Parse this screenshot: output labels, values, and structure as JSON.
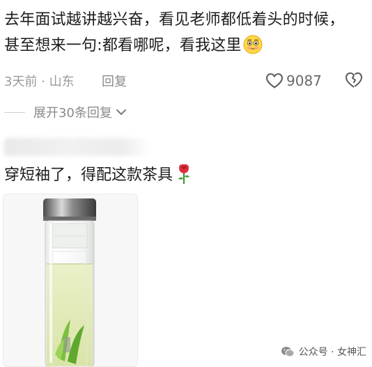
{
  "comment1": {
    "line1": "去年面试越讲越兴奋，看见老师都低着头的时候，",
    "line2": "甚至想来一句:都看哪呢，看我这里",
    "emoji_icon": "flushed-face-icon"
  },
  "meta": {
    "time_location": "3天前 · 山东",
    "reply_label": "回复",
    "like_count": "9087",
    "like_icon": "heart-outline-icon",
    "dislike_icon": "broken-heart-icon"
  },
  "expand": {
    "label": "展开30条回复",
    "icon": "chevron-down-icon"
  },
  "comment2": {
    "text": "穿短袖了，得配这款茶具",
    "emoji_icon": "rose-icon"
  },
  "watermark": {
    "text": "公众号 · 女神汇",
    "icon": "wechat-official-account-icon"
  }
}
